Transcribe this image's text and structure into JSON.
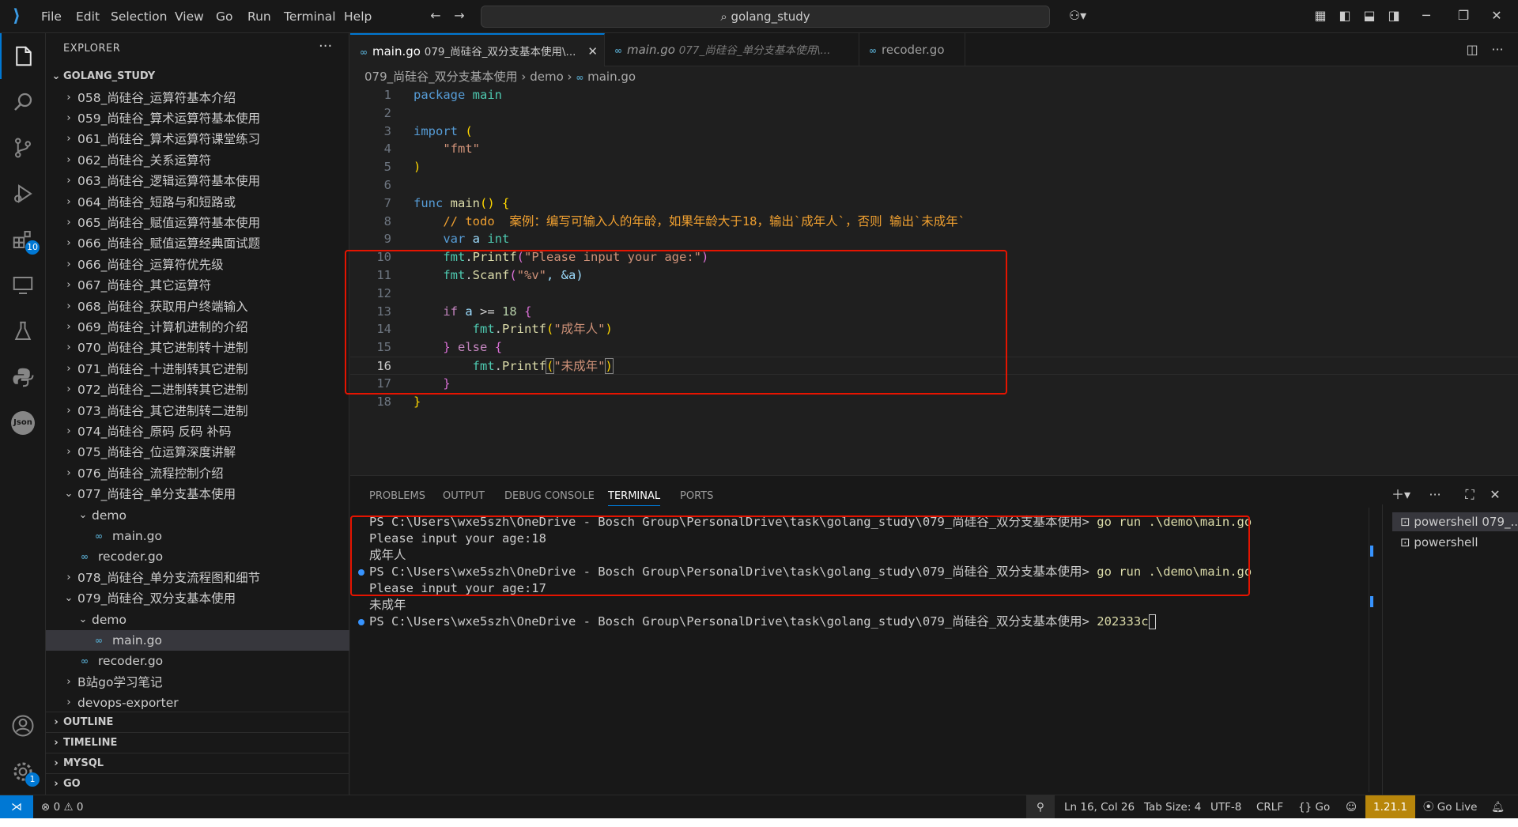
{
  "colors": {
    "accent": "#0078d4",
    "highlight_box": "#e51400",
    "go_version_bg": "#b8860b"
  },
  "titlebar": {
    "menu": [
      "File",
      "Edit",
      "Selection",
      "View",
      "Go",
      "Run",
      "Terminal",
      "Help"
    ],
    "search": "golang_study"
  },
  "activity": {
    "extensions_badge": "10",
    "settings_badge": "1",
    "json_label": "Json"
  },
  "sidebar": {
    "title": "EXPLORER",
    "root": "GOLANG_STUDY",
    "items": [
      {
        "label": "058_尚硅谷_运算符基本介绍"
      },
      {
        "label": "059_尚硅谷_算术运算符基本使用"
      },
      {
        "label": "061_尚硅谷_算术运算符课堂练习"
      },
      {
        "label": "062_尚硅谷_关系运算符"
      },
      {
        "label": "063_尚硅谷_逻辑运算符基本使用"
      },
      {
        "label": "064_尚硅谷_短路与和短路或"
      },
      {
        "label": "065_尚硅谷_赋值运算符基本使用"
      },
      {
        "label": "066_尚硅谷_赋值运算经典面试题"
      },
      {
        "label": "066_尚硅谷_运算符优先级"
      },
      {
        "label": "067_尚硅谷_其它运算符"
      },
      {
        "label": "068_尚硅谷_获取用户终端输入"
      },
      {
        "label": "069_尚硅谷_计算机进制的介绍"
      },
      {
        "label": "070_尚硅谷_其它进制转十进制"
      },
      {
        "label": "071_尚硅谷_十进制转其它进制"
      },
      {
        "label": "072_尚硅谷_二进制转其它进制"
      },
      {
        "label": "073_尚硅谷_其它进制转二进制"
      },
      {
        "label": "074_尚硅谷_原码 反码 补码"
      },
      {
        "label": "075_尚硅谷_位运算深度讲解"
      },
      {
        "label": "076_尚硅谷_流程控制介绍"
      },
      {
        "label": "077_尚硅谷_单分支基本使用"
      },
      {
        "label": "demo"
      },
      {
        "label": "main.go"
      },
      {
        "label": "recoder.go"
      },
      {
        "label": "078_尚硅谷_单分支流程图和细节"
      },
      {
        "label": "079_尚硅谷_双分支基本使用"
      },
      {
        "label": "demo"
      },
      {
        "label": "main.go"
      },
      {
        "label": "recoder.go"
      },
      {
        "label": "B站go学习笔记"
      },
      {
        "label": "devops-exporter"
      }
    ],
    "sections": [
      "OUTLINE",
      "TIMELINE",
      "MYSQL",
      "GO"
    ]
  },
  "tabs": [
    {
      "name": "main.go",
      "desc": "079_尚硅谷_双分支基本使用\\..."
    },
    {
      "name": "main.go",
      "desc": "077_尚硅谷_单分支基本使用\\..."
    },
    {
      "name": "recoder.go",
      "desc": ""
    }
  ],
  "breadcrumb": [
    "079_尚硅谷_双分支基本使用",
    "demo",
    "main.go"
  ],
  "code": {
    "line_numbers": [
      "1",
      "2",
      "3",
      "4",
      "5",
      "6",
      "7",
      "8",
      "9",
      "10",
      "11",
      "12",
      "13",
      "14",
      "15",
      "16",
      "17",
      "18"
    ],
    "l1_kw": "package",
    "l1_id": "main",
    "l3_kw": "import",
    "l3_p": "(",
    "l4_s": "\"fmt\"",
    "l5_p": ")",
    "l7_kw": "func",
    "l7_fn": "main",
    "l7_p": "() {",
    "l8_comment": "// todo  案例：编写可输入人的年龄，如果年龄大于18，输出`成年人`，否则 输出`未成年`",
    "l9_kw": "var",
    "l9_id": "a",
    "l9_type": "int",
    "l10_pkg": "fmt",
    "l10_fn": "Printf",
    "l10_s": "\"Please input your age:\"",
    "l11_pkg": "fmt",
    "l11_fn": "Scanf",
    "l11_s": "\"%v\"",
    "l11_rest": ", &a)",
    "l13_kw": "if",
    "l13_id": "a",
    "l13_op": ">=",
    "l13_num": "18",
    "l13_p": "{",
    "l14_pkg": "fmt",
    "l14_fn": "Printf",
    "l14_s": "\"成年人\"",
    "l15_p1": "}",
    "l15_kw": "else",
    "l15_p2": "{",
    "l16_pkg": "fmt",
    "l16_fn": "Printf",
    "l16_s": "\"未成年\"",
    "l17_p": "}",
    "l18_p": "}"
  },
  "panel": {
    "tabs": [
      "PROBLEMS",
      "OUTPUT",
      "DEBUG CONSOLE",
      "TERMINAL",
      "PORTS"
    ],
    "terminal": {
      "prompt": "PS C:\\Users\\wxe5szh\\OneDrive - Bosch Group\\PersonalDrive\\task\\golang_study\\079_尚硅谷_双分支基本使用>",
      "cmd": "go run .\\demo\\main.go",
      "out1": "Please input your age:18",
      "out2": "成年人",
      "out3": "Please input your age:17",
      "out4": "未成年",
      "typed": "202333c"
    },
    "shells": [
      "powershell  079_...",
      "powershell"
    ]
  },
  "statusbar": {
    "errors": "0",
    "warnings": "0",
    "position": "Ln 16, Col 26",
    "tabsize": "Tab Size: 4",
    "encoding": "UTF-8",
    "eol": "CRLF",
    "language": "Go",
    "go_version": "1.21.1",
    "golive": "Go Live"
  }
}
